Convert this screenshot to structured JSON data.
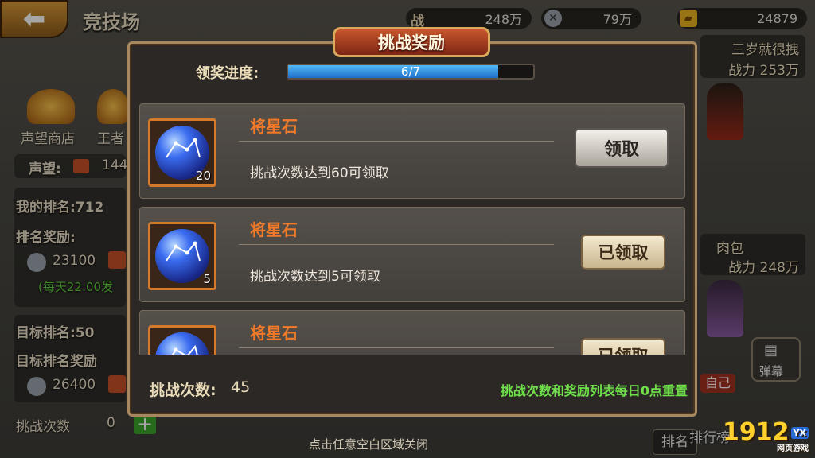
{
  "header": {
    "back_glyph": "⬅",
    "title": "竞技场",
    "resources": [
      {
        "icon": "combat-icon",
        "label": "战",
        "value": "248万"
      },
      {
        "icon": "silver-coin-icon",
        "value": "79万"
      },
      {
        "icon": "gold-ingot-icon",
        "value": "24879"
      }
    ]
  },
  "background_left": {
    "shop1": "声望商店",
    "shop2": "王者",
    "prestige_label": "声望:",
    "prestige_value": "144",
    "my_rank": "我的排名:712",
    "rank_reward": "排名奖励:",
    "reward_value": "23100",
    "daily_note": "(每天22:00发",
    "target_rank": "目标排名:50",
    "target_reward": "目标排名奖励",
    "target_value": "26400",
    "challenge_count": "挑战次数",
    "challenge_count_value": "0"
  },
  "background_right": {
    "opponent1_name": "三岁就很拽",
    "opponent1_power": "战力 253万",
    "opponent2_name": "肉包",
    "opponent2_power": "战力 248万",
    "self_label": "自己",
    "danmaku_label": "弹幕",
    "rank_label": "排名",
    "leaderboard_label": "排行榜"
  },
  "modal": {
    "title": "挑战奖励",
    "progress_label": "领奖进度:",
    "progress_text": "6/7",
    "progress_fraction": 0.857,
    "rewards": [
      {
        "name": "将星石",
        "quantity": "20",
        "condition": "挑战次数达到60可领取",
        "button": "领取",
        "state": "claimable"
      },
      {
        "name": "将星石",
        "quantity": "5",
        "condition": "挑战次数达到5可领取",
        "button": "已领取",
        "state": "claimed"
      },
      {
        "name": "将星石",
        "quantity": "",
        "condition": "",
        "button": "已领取",
        "state": "claimed"
      }
    ],
    "attempts_label": "挑战次数:",
    "attempts_value": "45",
    "reset_note": "挑战次数和奖励列表每日0点重置"
  },
  "close_hint": "点击任意空白区域关闭",
  "watermark": {
    "text": "1912",
    "badge": "YX",
    "sub": "网页游戏"
  },
  "colors": {
    "accent_orange": "#f07a2a",
    "note_green": "#6fe04a",
    "progress_blue": "#2f8fe0",
    "title_red": "#a8351c",
    "frame_gold": "#a6875e"
  }
}
